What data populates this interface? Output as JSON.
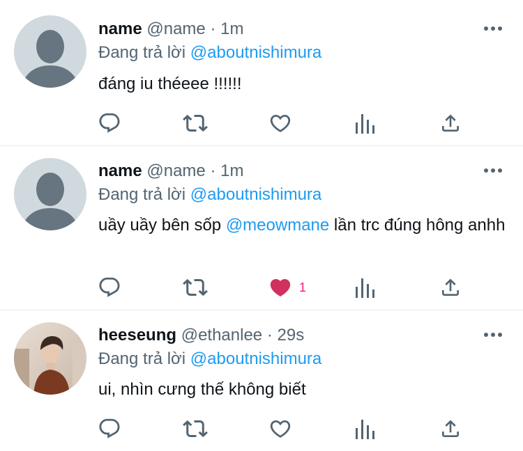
{
  "colors": {
    "text": "#0f1419",
    "muted": "#536471",
    "link": "#1d9bf0",
    "like": "#f91880",
    "divider": "#e6e9ec"
  },
  "tweets": [
    {
      "display_name": "name",
      "handle": "@name",
      "separator": "·",
      "time": "1m",
      "reply_prefix": "Đang trả lời",
      "reply_to": "@aboutnishimura",
      "text": "đáng iu théeee !!!!!!",
      "liked": false,
      "like_count": "",
      "avatar": "default-avatar"
    },
    {
      "display_name": "name",
      "handle": "@name",
      "separator": "·",
      "time": "1m",
      "reply_prefix": "Đang trả lời",
      "reply_to": "@aboutnishimura",
      "text_before": "uầy uầy bên sốp ",
      "text_mention": "@meowmane",
      "text_after": " lần trc đúng hông anhh",
      "liked": true,
      "like_count": "1",
      "avatar": "default-avatar"
    },
    {
      "display_name": "heeseung",
      "handle": "@ethanlee",
      "separator": "·",
      "time": "29s",
      "reply_prefix": "Đang trả lời",
      "reply_to": "@aboutnishimura",
      "text": "ui, nhìn cưng thế không biết",
      "liked": false,
      "like_count": "",
      "avatar": "photo-avatar"
    }
  ],
  "icons": [
    "reply-icon",
    "retweet-icon",
    "like-icon",
    "stats-icon",
    "share-icon",
    "more-icon"
  ]
}
